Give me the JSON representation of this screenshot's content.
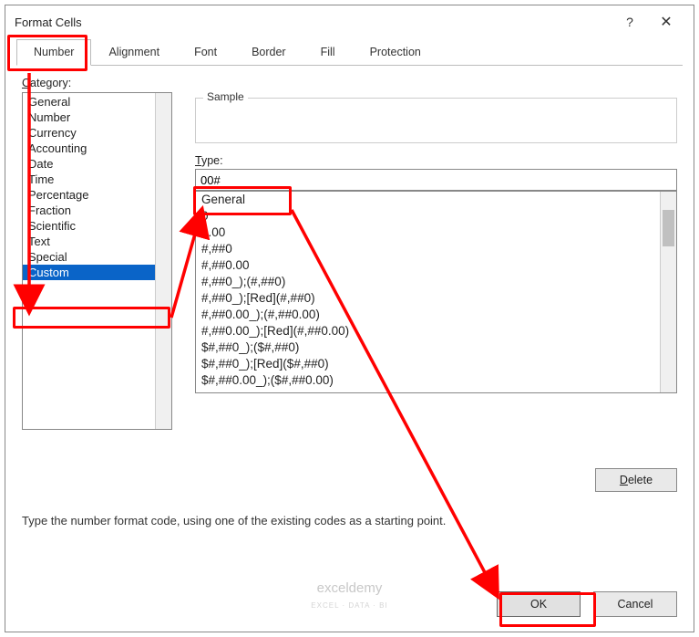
{
  "window": {
    "title": "Format Cells",
    "help_label": "?",
    "close_label": "✕"
  },
  "tabs": {
    "number": "Number",
    "alignment": "Alignment",
    "font": "Font",
    "border": "Border",
    "fill": "Fill",
    "protection": "Protection"
  },
  "labels": {
    "category": "Category:",
    "sample": "Sample",
    "type": "Type:",
    "delete": "Delete",
    "hint": "Type the number format code, using one of the existing codes as a starting point.",
    "ok": "OK",
    "cancel": "Cancel"
  },
  "categories": [
    "General",
    "Number",
    "Currency",
    "Accounting",
    "Date",
    "Time",
    "Percentage",
    "Fraction",
    "Scientific",
    "Text",
    "Special",
    "Custom"
  ],
  "selected_category_index": 11,
  "type_value": "00#",
  "format_list": [
    "General",
    "0",
    "0.00",
    "#,##0",
    "#,##0.00",
    "#,##0_);(#,##0)",
    "#,##0_);[Red](#,##0)",
    "#,##0.00_);(#,##0.00)",
    "#,##0.00_);[Red](#,##0.00)",
    "$#,##0_);($#,##0)",
    "$#,##0_);[Red]($#,##0)",
    "$#,##0.00_);($#,##0.00)"
  ],
  "watermark": {
    "main": "exceldemy",
    "sub": "EXCEL · DATA · BI"
  }
}
